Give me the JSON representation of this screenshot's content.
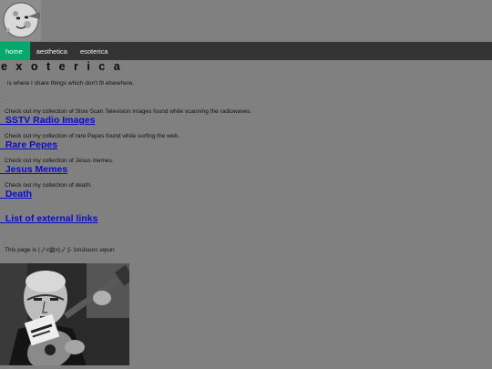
{
  "logo": {
    "icon": "moon-face-icon"
  },
  "nav": {
    "items": [
      {
        "label": "home",
        "active": true
      },
      {
        "label": "aesthetica",
        "active": false
      },
      {
        "label": "esoterica",
        "active": false
      }
    ]
  },
  "page": {
    "title": "e x o t e r i c a",
    "intro": "is where I share things which don't fit elsewhere."
  },
  "sections": [
    {
      "desc": "Check out my collection of Slow Scan Television images found while scanning the radiowaves.",
      "link": "SSTV Radio Images"
    },
    {
      "desc": "Check out my collection of rare Pepes found while surfing the web.",
      "link": "Rare Pepes"
    },
    {
      "desc": "Check out my collection of Jesus memes.",
      "link": "Jesus Memes"
    },
    {
      "desc": "Check out my collection of death.",
      "link": "Death"
    },
    {
      "desc": "",
      "link": "List of external links"
    }
  ],
  "status": {
    "text": "This page is (ノಠ益ಠ)ノ彡 ʇɔnɹʇsuoɔ ɹǝpun"
  },
  "photo": {
    "icon": "man-with-guitar-photo"
  },
  "colors": {
    "background": "#808080",
    "navbar": "#333333",
    "nav_active": "#04AA6D",
    "link": "#0b0bd0"
  }
}
